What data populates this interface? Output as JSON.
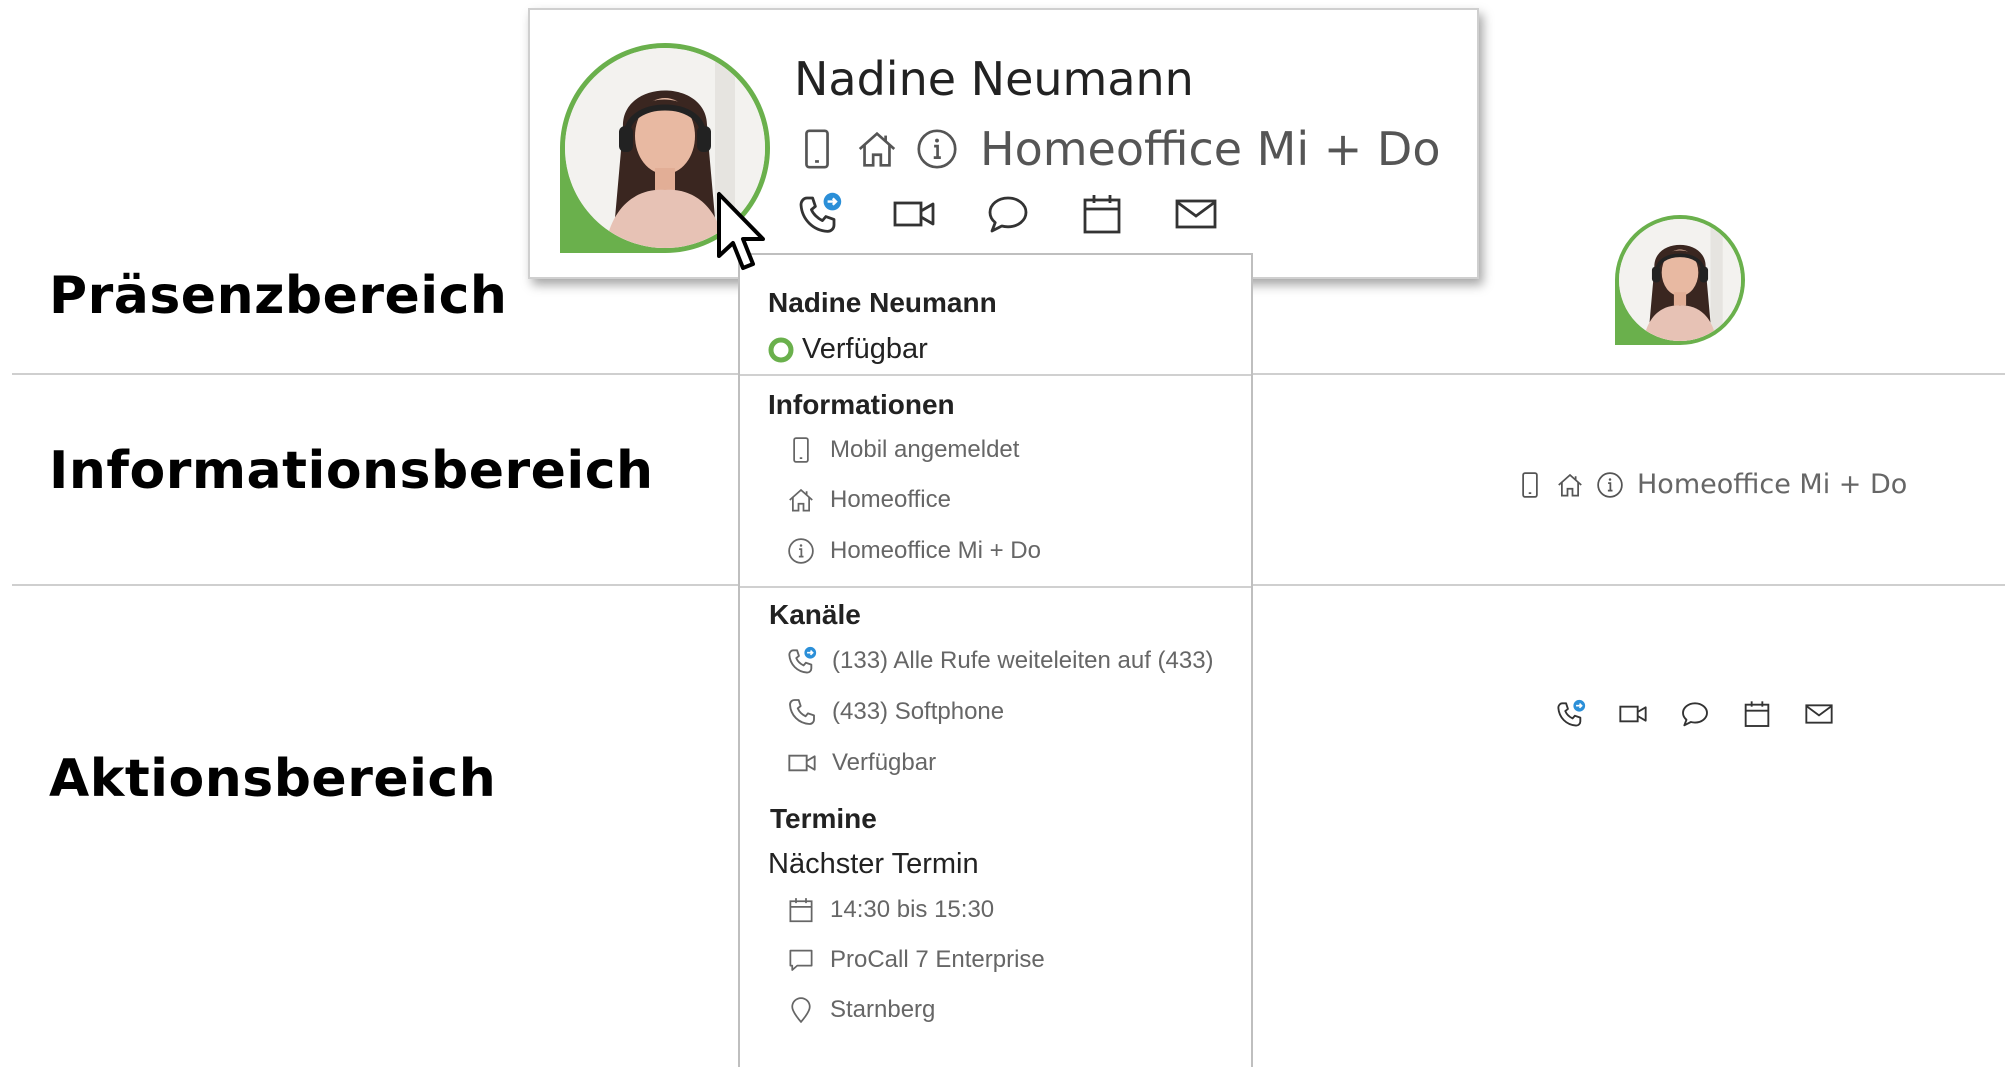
{
  "sections": {
    "presence": "Präsenzbereich",
    "information": "Informationsbereich",
    "actions": "Aktionsbereich"
  },
  "colors": {
    "presence_green": "#6ab04c",
    "forward_blue": "#2b8fd8",
    "icon_gray": "#555555"
  },
  "card": {
    "name": "Nadine Neumann",
    "info_icons": [
      "mobile-icon",
      "home-icon",
      "info-icon"
    ],
    "info_text": "Homeoffice Mi + Do",
    "actions": [
      "phone-forward-icon",
      "video-icon",
      "chat-icon",
      "calendar-icon",
      "mail-icon"
    ]
  },
  "panel": {
    "name": "Nadine Neumann",
    "status": "Verfügbar",
    "info_heading": "Informationen",
    "info_items": [
      "Mobil angemeldet",
      "Homeoffice",
      "Homeoffice Mi + Do"
    ],
    "channels_heading": "Kanäle",
    "channel_items": [
      "(133) Alle Rufe weiteleiten auf (433)",
      "(433) Softphone",
      "Verfügbar"
    ],
    "appointments_heading": "Termine",
    "next_label": "Nächster Termin",
    "appointment_items": [
      "14:30 bis 15:30",
      "ProCall 7 Enterprise",
      "Starnberg"
    ]
  },
  "mini": {
    "info_text": "Homeoffice Mi + Do"
  }
}
